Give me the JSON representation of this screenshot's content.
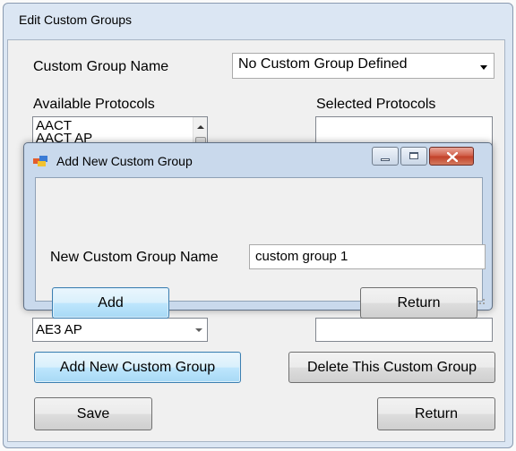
{
  "window": {
    "title": "Edit Custom Groups"
  },
  "form": {
    "custom_group_name_label": "Custom Group Name",
    "custom_group_dropdown": {
      "selected": "No Custom Group Defined"
    },
    "available_protocols_label": "Available Protocols",
    "selected_protocols_label": "Selected Protocols",
    "available_protocols": [
      "AACT",
      "AACT AP"
    ],
    "lower_available_protocols": [
      "AE3 AP"
    ],
    "add_new_custom_group_label": "Add New Custom Group",
    "delete_custom_group_label": "Delete This Custom Group",
    "save_label": "Save",
    "return_label": "Return"
  },
  "dialog": {
    "title": "Add New Custom Group",
    "new_group_name_label": "New Custom Group Name",
    "new_group_name_value": "custom group 1",
    "add_label": "Add",
    "return_label": "Return"
  },
  "icons": {
    "dropdown": "chevron-down-icon",
    "dialog_app": "form-icon",
    "minimize": "minimize-icon",
    "maximize": "maximize-icon",
    "close": "close-icon"
  },
  "colors": {
    "focus_button": "#bee6fd",
    "close_button": "#c94f3a",
    "window_frame": "#dbe6f3"
  }
}
